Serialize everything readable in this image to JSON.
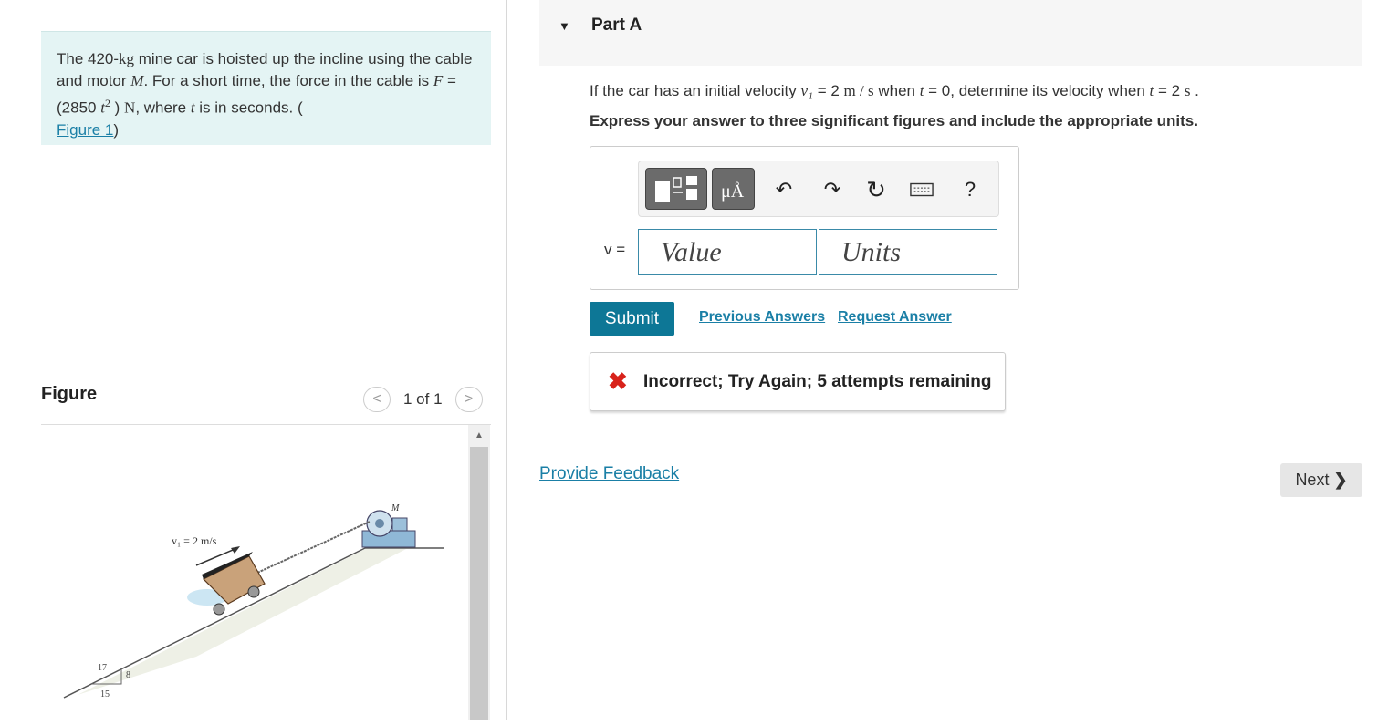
{
  "problem": {
    "pre_mass": "The 420-",
    "mass_unit": "kg",
    "post_mass": " mine car is hoisted up the incline using the cable and motor ",
    "motor": "M",
    "mid": ". For a short time, the force in the cable is ",
    "force_var": "F",
    "force_eq": " = (2850 ",
    "t_var": "t",
    "t_exp": "2",
    "force_close": " ) ",
    "force_unit": "N",
    "where": ", where ",
    "t_var2": "t",
    "seconds": " is in seconds. (",
    "figure_link": "Figure 1",
    "close": ")"
  },
  "figure": {
    "title": "Figure",
    "pager": "1 of 1",
    "prev_icon": "<",
    "next_icon": ">",
    "motor_label": "M",
    "v_label": "v₁ = 2 m/s",
    "slope_17": "17",
    "slope_8": "8",
    "slope_15": "15"
  },
  "part": {
    "title": "Part A",
    "q1": "If the car has an initial velocity ",
    "q_v1": "v₁",
    "q2": " = 2 ",
    "q_unit": "m / s",
    "q3": " when ",
    "q_t": "t",
    "q4": " = 0, determine its velocity when ",
    "q_t2": "t",
    "q5": " = 2 ",
    "q_s": "s",
    "q6": " .",
    "instruction": "Express your answer to three significant figures and include the appropriate units."
  },
  "answer": {
    "var_label": "v =",
    "value_placeholder": "Value",
    "units_placeholder": "Units",
    "units_btn": "μÅ",
    "help": "?"
  },
  "actions": {
    "submit": "Submit",
    "previous_answers": "Previous Answers",
    "request_answer": "Request Answer"
  },
  "feedback": {
    "icon": "✖",
    "text": "Incorrect; Try Again; 5 attempts remaining"
  },
  "footer": {
    "provide_feedback": "Provide Feedback",
    "next": "Next",
    "next_icon": "❯"
  }
}
